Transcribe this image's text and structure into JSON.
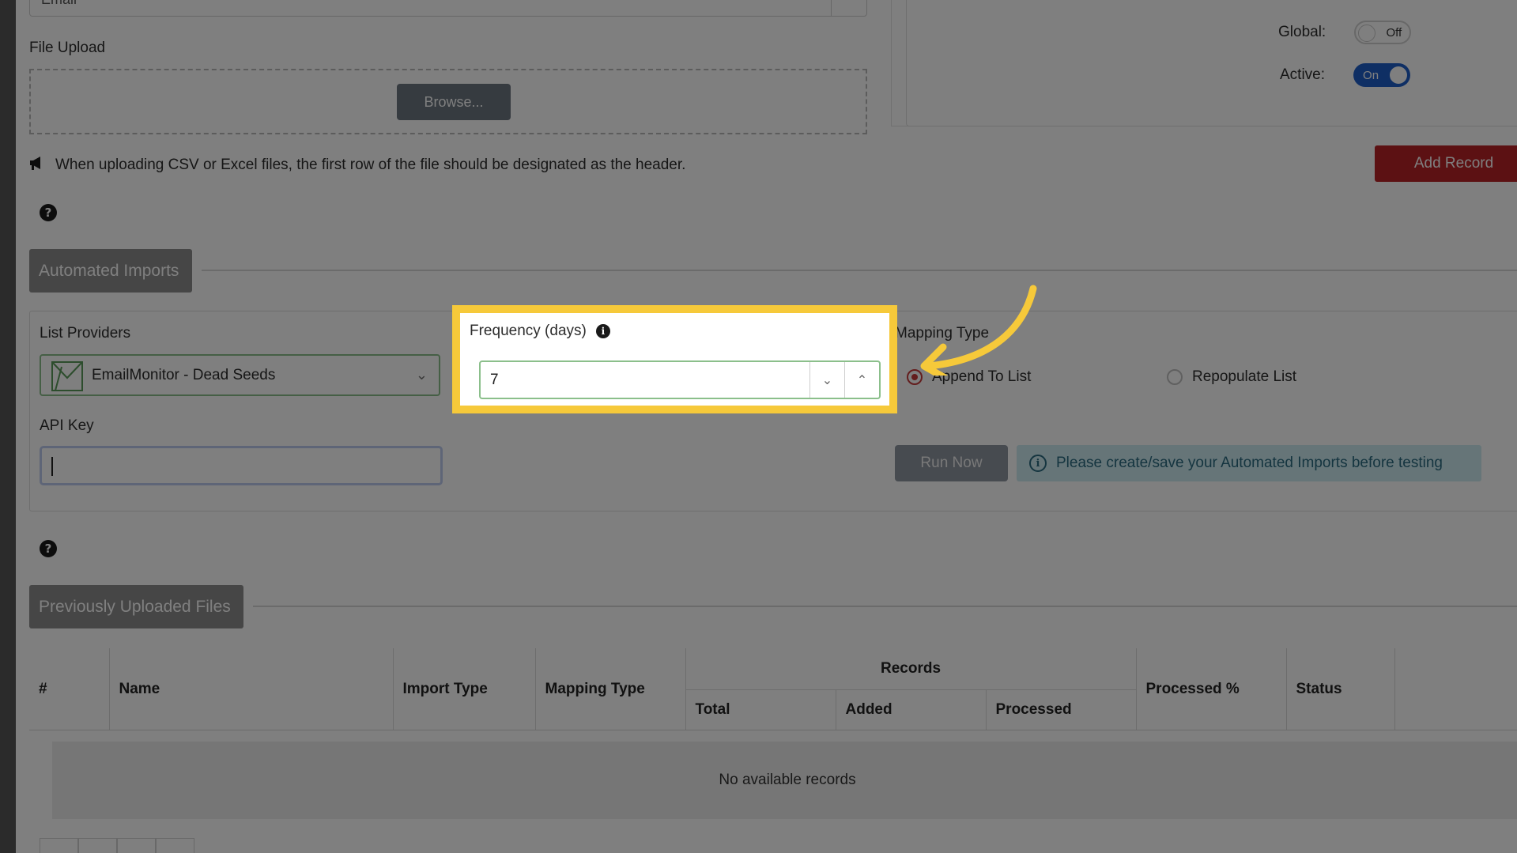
{
  "top_select": {
    "value": "Email"
  },
  "file_upload": {
    "label": "File Upload",
    "browse_label": "Browse...",
    "notice": "When uploading CSV or Excel files, the first row of the file should be designated as the header."
  },
  "settings": {
    "global_label": "Global:",
    "global_state": "Off",
    "active_label": "Active:",
    "active_state": "On",
    "add_record_label": "Add Record"
  },
  "automated_imports": {
    "title": "Automated Imports",
    "list_providers_label": "List Providers",
    "provider_value": "EmailMonitor - Dead Seeds",
    "api_key_label": "API Key",
    "api_key_value": "",
    "frequency_label": "Frequency (days)",
    "frequency_value": "7",
    "mapping_type_label": "Mapping Type",
    "mapping_options": [
      "Append To List",
      "Repopulate List"
    ],
    "mapping_selected": "Append To List",
    "run_now_label": "Run Now",
    "info_message": "Please create/save your Automated Imports before testing"
  },
  "previous_uploads": {
    "title": "Previously Uploaded Files",
    "group_header": "Records",
    "columns": [
      "#",
      "Name",
      "Import Type",
      "Mapping Type",
      "Total",
      "Added",
      "Processed",
      "Processed %",
      "Status"
    ],
    "empty_message": "No available records"
  },
  "colors": {
    "highlight": "#f6c93a",
    "add_record": "#b92226",
    "toggle_on": "#1f5fc9",
    "info_bg": "#cdebf1"
  }
}
